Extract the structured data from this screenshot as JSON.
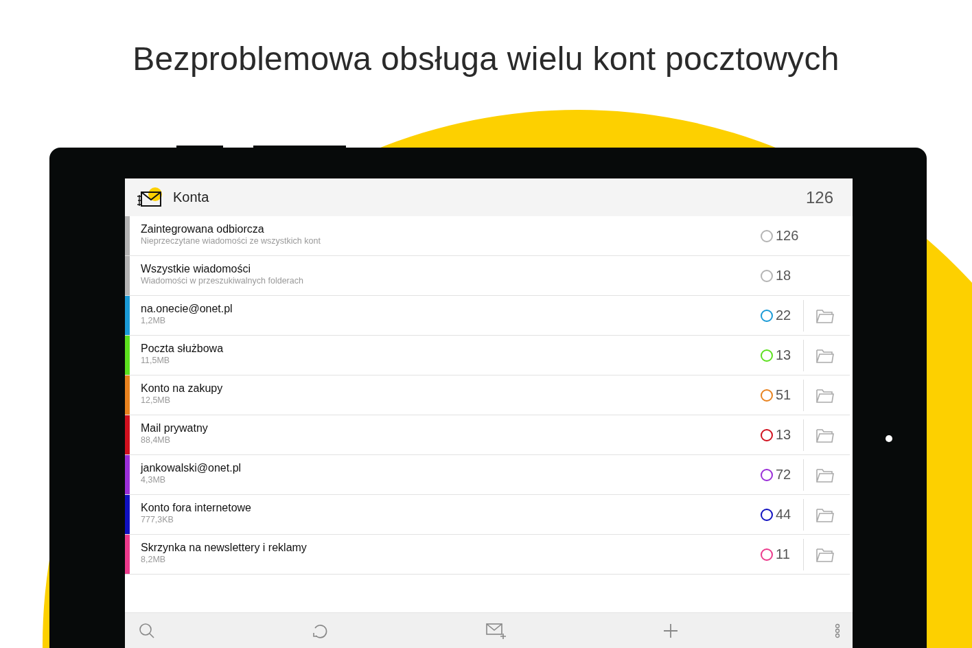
{
  "headline": "Bezproblemowa obsługa wielu kont pocztowych",
  "header": {
    "title": "Konta",
    "count": "126"
  },
  "accounts": [
    {
      "kind": "virtual",
      "name": "Zaintegrowana odbiorcza",
      "detail": "Nieprzeczytane wiadomości ze wszystkich kont",
      "count": "126",
      "color": "#b4b4b4"
    },
    {
      "kind": "virtual",
      "name": "Wszystkie wiadomości",
      "detail": "Wiadomości w przeszukiwalnych folderach",
      "count": "18",
      "color": "#b4b4b4"
    },
    {
      "kind": "account",
      "name": "na.onecie@onet.pl",
      "detail": "1,2MB",
      "count": "22",
      "color": "#1a9ad6"
    },
    {
      "kind": "account",
      "name": "Poczta służbowa",
      "detail": "11,5MB",
      "count": "13",
      "color": "#5ce01e"
    },
    {
      "kind": "account",
      "name": "Konto na zakupy",
      "detail": "12,5MB",
      "count": "51",
      "color": "#e8821e"
    },
    {
      "kind": "account",
      "name": "Mail prywatny",
      "detail": "88,4MB",
      "count": "13",
      "color": "#d0101e"
    },
    {
      "kind": "account",
      "name": "jankowalski@onet.pl",
      "detail": "4,3MB",
      "count": "72",
      "color": "#9a2ed8"
    },
    {
      "kind": "account",
      "name": "Konto fora internetowe",
      "detail": "777,3KB",
      "count": "44",
      "color": "#1010c0"
    },
    {
      "kind": "account",
      "name": "Skrzynka na newslettery i reklamy",
      "detail": "8,2MB",
      "count": "11",
      "color": "#ec3a8c"
    }
  ]
}
